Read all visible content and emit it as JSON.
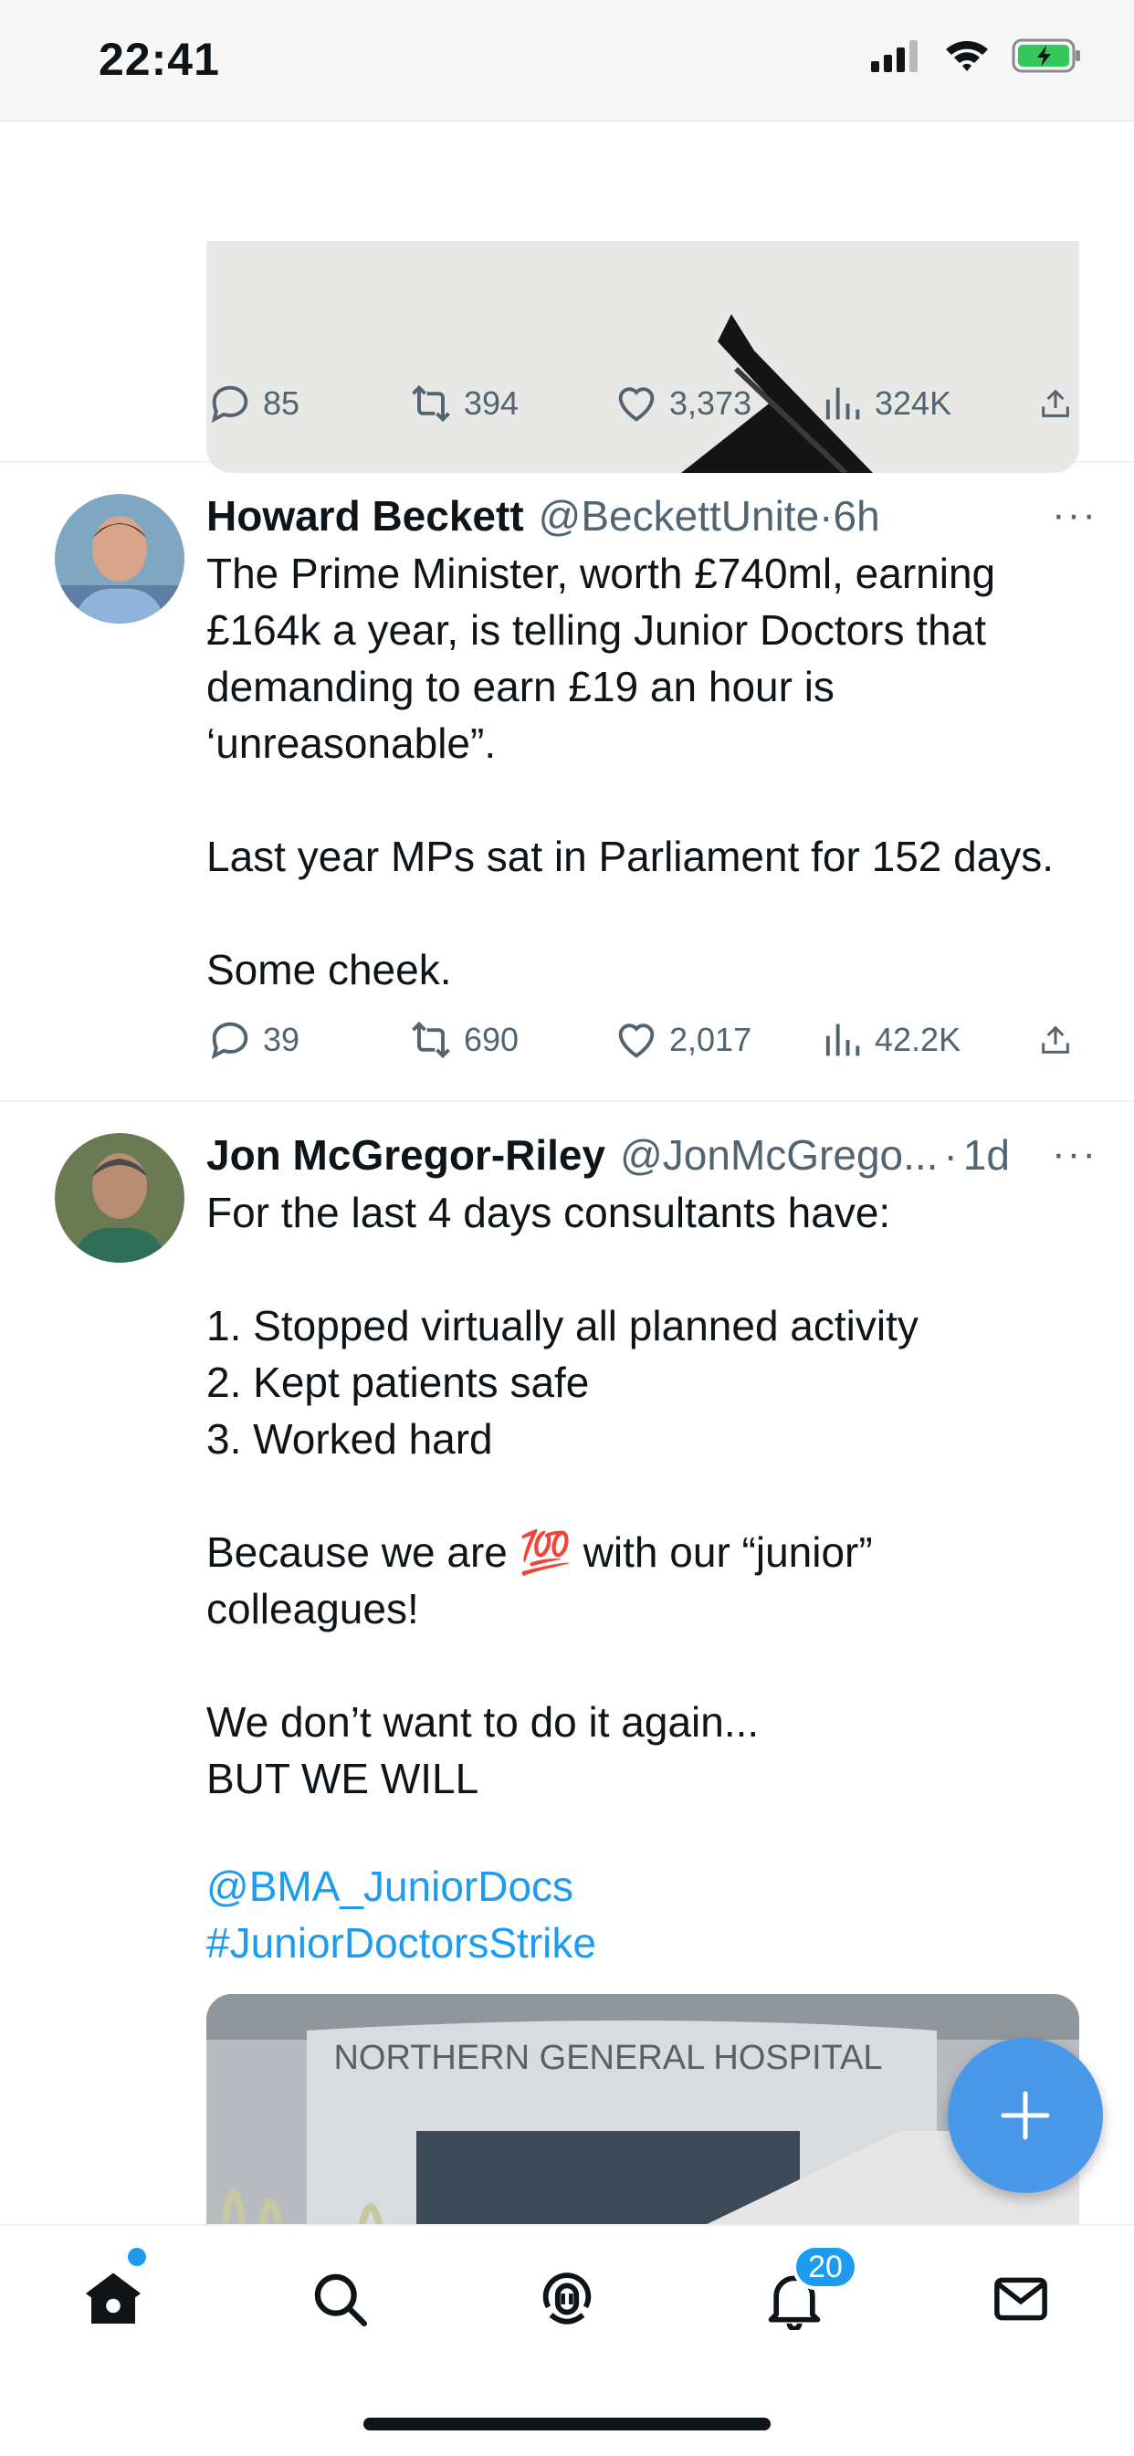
{
  "status_bar": {
    "time": "22:41"
  },
  "tweet0": {
    "stats": {
      "replies": "85",
      "retweets": "394",
      "likes": "3,373",
      "views": "324K"
    }
  },
  "tweet1": {
    "name": "Howard Beckett",
    "handle": "@BeckettUnite",
    "dot": "·",
    "ago": "6h",
    "text": "The Prime Minister, worth £740ml, earning £164k a year, is telling Junior Doctors that demanding to earn £19 an hour is ‘unreasonable”.\n\nLast year MPs sat in Parliament for 152 days.\n\nSome cheek.",
    "stats": {
      "replies": "39",
      "retweets": "690",
      "likes": "2,017",
      "views": "42.2K"
    }
  },
  "tweet2": {
    "name": "Jon McGregor-Riley",
    "handle": "@JonMcGrego...",
    "dot": "·",
    "ago": "1d",
    "text": "For the last 4 days consultants have:\n\n1. Stopped virtually all planned activity\n2. Kept patients safe\n3. Worked hard\n\nBecause we are 💯 with our “junior” colleagues!\n\nWe don’t want to do it again...\nBUT WE WILL",
    "mention": "@BMA_JuniorDocs",
    "hashtag": "#JuniorDoctorsStrike",
    "image_sign": "NORTHERN GENERAL HOSPITAL"
  },
  "more_label": "···",
  "tab_bar": {
    "items": [
      "home-icon",
      "search-icon",
      "spaces-icon",
      "notifications-icon",
      "messages-icon"
    ],
    "notifications_badge": "20"
  },
  "colors": {
    "accent": "#1d9bf0",
    "fab": "#4a99e9",
    "battery": "#34c759",
    "text_secondary": "#536471"
  }
}
